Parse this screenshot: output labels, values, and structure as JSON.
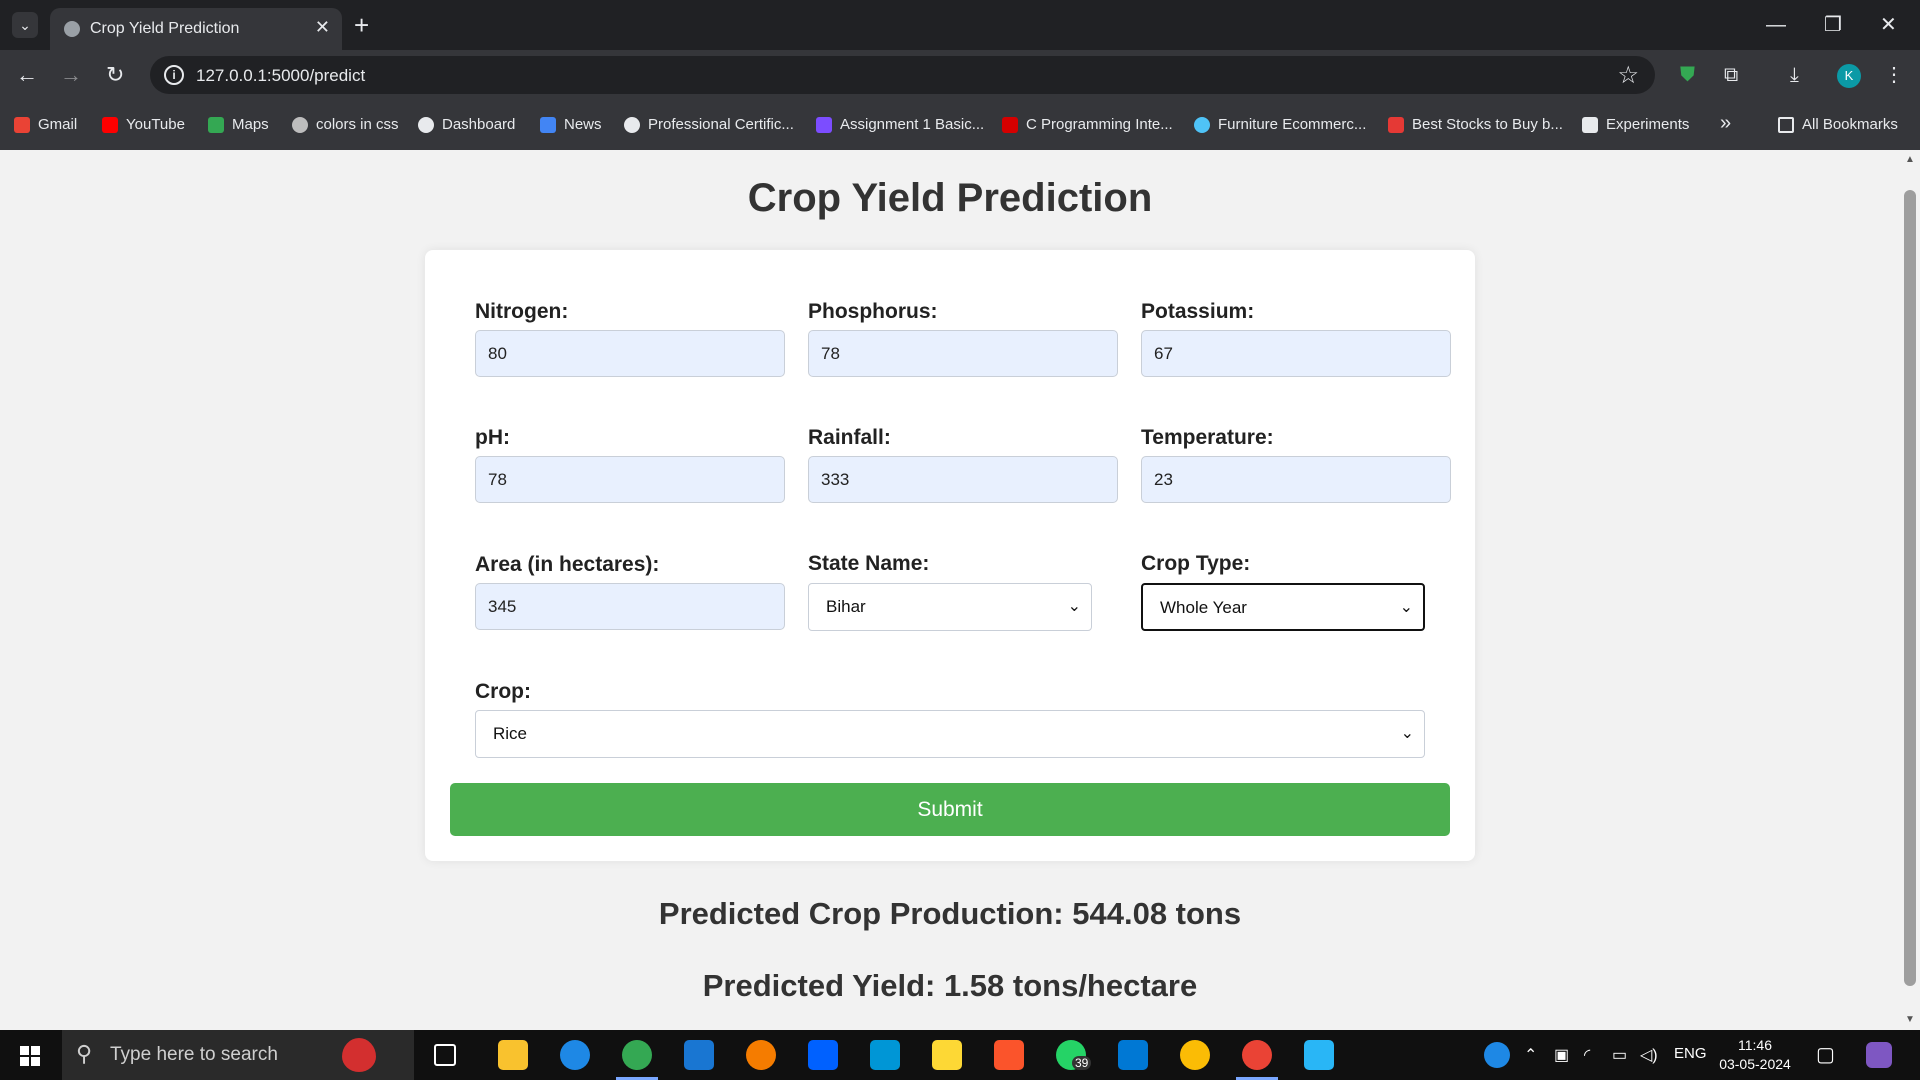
{
  "browser": {
    "tab_title": "Crop Yield Prediction",
    "url": "127.0.0.1:5000/predict",
    "profile_initial": "K",
    "bookmarks": [
      {
        "label": "Gmail",
        "color": "#ea4335"
      },
      {
        "label": "YouTube",
        "color": "#ff0000"
      },
      {
        "label": "Maps",
        "color": "#34a853"
      },
      {
        "label": "colors in css",
        "color": "#bdbdbd"
      },
      {
        "label": "Dashboard",
        "color": "#e8eaed"
      },
      {
        "label": "News",
        "color": "#4285f4"
      },
      {
        "label": "Professional Certific...",
        "color": "#e8eaed"
      },
      {
        "label": "Assignment 1 Basic...",
        "color": "#7c4dff"
      },
      {
        "label": "C Programming Inte...",
        "color": "#d50000"
      },
      {
        "label": "Furniture Ecommerc...",
        "color": "#4fc3f7"
      },
      {
        "label": "Best Stocks to Buy b...",
        "color": "#e53935"
      },
      {
        "label": "Experiments",
        "color": "#e8eaed"
      }
    ],
    "more_bookmarks": "»",
    "all_bookmarks": "All Bookmarks"
  },
  "page": {
    "heading": "Crop Yield Prediction",
    "fields": {
      "nitrogen": {
        "label": "Nitrogen:",
        "value": "80"
      },
      "phosphorus": {
        "label": "Phosphorus:",
        "value": "78"
      },
      "potassium": {
        "label": "Potassium:",
        "value": "67"
      },
      "ph": {
        "label": "pH:",
        "value": "78"
      },
      "rainfall": {
        "label": "Rainfall:",
        "value": "333"
      },
      "temperature": {
        "label": "Temperature:",
        "value": "23"
      },
      "area": {
        "label": "Area (in hectares):",
        "value": "345"
      },
      "state": {
        "label": "State Name:",
        "value": "Bihar"
      },
      "crop_type": {
        "label": "Crop Type:",
        "value": "Whole Year"
      },
      "crop": {
        "label": "Crop:",
        "value": "Rice"
      }
    },
    "submit_label": "Submit",
    "result_production": "Predicted Crop Production: 544.08 tons",
    "result_yield": "Predicted Yield: 1.58 tons/hectare"
  },
  "taskbar": {
    "search_placeholder": "Type here to search",
    "whatsapp_badge": "39",
    "language": "ENG",
    "time": "11:46",
    "date": "03-05-2024"
  },
  "colors": {
    "submit": "#4caf50",
    "input_fill": "#e8f0fe"
  }
}
